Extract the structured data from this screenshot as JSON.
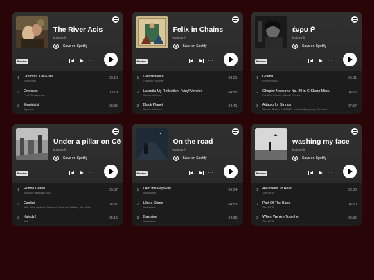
{
  "colors": {
    "background": "#2a0508",
    "card": "#1c1c1c",
    "badge": "#e0e0e0"
  },
  "labels": {
    "save": "Save on Spotify",
    "preview": "Preview",
    "more": "···"
  },
  "cards": [
    {
      "title": "The River Acis",
      "artist": "kudaya fi",
      "cover": "painting",
      "tracks": [
        {
          "num": "1",
          "title": "Gramma Kai Grafi",
          "artist": "Eleni Vitali",
          "duration": "03:10"
        },
        {
          "num": "2",
          "title": "Стрижок",
          "artist": "Руся Лохманенко",
          "duration": "03:19"
        },
        {
          "num": "3",
          "title": "Empiricist",
          "artist": "Typhoon",
          "duration": "08:35"
        }
      ]
    },
    {
      "title": "Felix in Chains",
      "artist": "kudaya fi",
      "cover": "medieval",
      "tracks": [
        {
          "num": "1",
          "title": "Gallowdance",
          "artist": "Lebanon Hanover",
          "duration": "03:51"
        },
        {
          "num": "2",
          "title": "Lucretia My Reflection - Vinyl Version",
          "artist": "Sisters of Mercy",
          "duration": "04:55"
        },
        {
          "num": "3",
          "title": "Black Planet",
          "artist": "Sisters of Mercy",
          "duration": "04:41"
        }
      ]
    },
    {
      "title": "ένρυ ᑭ",
      "artist": "kudaya fi",
      "cover": "dark-portrait",
      "tracks": [
        {
          "num": "1",
          "title": "Goetia",
          "artist": "Peter Gundry",
          "duration": "05:01"
        },
        {
          "num": "2",
          "title": "Chopin: Nocturne No. 20 in C-Sharp Mino...",
          "artist": "Frédéric Chopin, Mikhail Pletnev",
          "duration": "04:26"
        },
        {
          "num": "3",
          "title": "Adagio for Strings",
          "artist": "Samuel Barber, HAUSER, London Symphony Orchestr...",
          "duration": "07:57"
        }
      ]
    },
    {
      "title": "Under a pillar on Cē",
      "artist": "kudaya fi",
      "cover": "ruins",
      "tracks": [
        {
          "num": "1",
          "title": "Hunnu Guren",
          "artist": "Batzorig Vaanchig, Asll",
          "duration": "03:57"
        },
        {
          "num": "2",
          "title": "Ozoliņi",
          "artist": "Auli, Suitu ziedava, Suitu vīri, Suitu dziedātājas, Ilze, Ditte...",
          "duration": "04:37"
        },
        {
          "num": "3",
          "title": "Kaladzi!",
          "artist": "Auli",
          "duration": "05:16"
        }
      ]
    },
    {
      "title": "On the road",
      "artist": "kudaya fi",
      "cover": "night-road",
      "tracks": [
        {
          "num": "1",
          "title": "I Am the Highway",
          "artist": "Audioslave",
          "duration": "05:34"
        },
        {
          "num": "2",
          "title": "Like a Stone",
          "artist": "Audioslave",
          "duration": "04:53"
        },
        {
          "num": "3",
          "title": "Gasoline",
          "artist": "Audioslave",
          "duration": "04:39"
        }
      ]
    },
    {
      "title": "washing my face",
      "artist": "kudaya fi",
      "cover": "bird-figure",
      "tracks": [
        {
          "num": "1",
          "title": "All I Need To Hear",
          "artist": "The 1975",
          "duration": "03:30"
        },
        {
          "num": "2",
          "title": "Part Of The Band",
          "artist": "The 1975",
          "duration": "04:20"
        },
        {
          "num": "3",
          "title": "When We Are Together",
          "artist": "The 1975",
          "duration": "03:36"
        }
      ]
    }
  ]
}
